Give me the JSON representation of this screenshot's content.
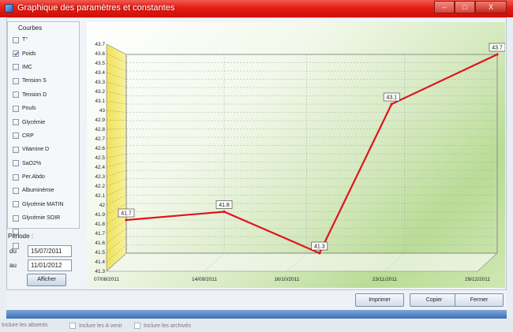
{
  "window": {
    "title": "Graphique des paramètres et constantes",
    "controls": {
      "minimize": "–",
      "maximize": "□",
      "close": "X"
    }
  },
  "curves": {
    "title": "Courbes",
    "items": [
      {
        "label": "T°",
        "checked": false
      },
      {
        "label": "Poids",
        "checked": true
      },
      {
        "label": "IMC",
        "checked": false
      },
      {
        "label": "Tension S",
        "checked": false
      },
      {
        "label": "Tension D",
        "checked": false
      },
      {
        "label": "Pouls",
        "checked": false
      },
      {
        "label": "Glycémie",
        "checked": false
      },
      {
        "label": "CRP",
        "checked": false
      },
      {
        "label": "Vitamine D",
        "checked": false
      },
      {
        "label": "SaO2%",
        "checked": false
      },
      {
        "label": "Per.Abdo",
        "checked": false
      },
      {
        "label": "Albuminémie",
        "checked": false
      },
      {
        "label": "Glycémie MATIN",
        "checked": false
      },
      {
        "label": "Glycémie SOIR",
        "checked": false
      },
      {
        "label": "",
        "checked": false
      },
      {
        "label": "",
        "checked": false
      }
    ]
  },
  "period": {
    "label": "Période :",
    "from_label": "du",
    "from_value": "15/07/2011",
    "to_label": "au",
    "to_value": "11/01/2012",
    "show_button": "Afficher"
  },
  "buttons": {
    "print": "Imprimer",
    "copy": "Copier",
    "close": "Fermer"
  },
  "background_row": {
    "items": [
      "Inclure les absents",
      "Inclure les A venir",
      "Inclure les archivés"
    ]
  },
  "colors": {
    "title_bar": "#e41f15",
    "series_line": "#e0141b",
    "side_wall": "#f4e96a",
    "accent_blue": "#3b6fb8"
  },
  "chart_data": {
    "type": "line",
    "title": "",
    "xlabel": "",
    "ylabel": "",
    "ylim": [
      41.3,
      43.7
    ],
    "y_tick_step": 0.1,
    "grid": true,
    "x_ticks": [
      "07/08/2011",
      "14/09/2011",
      "16/10/2011",
      "23/11/2011",
      "29/12/2011"
    ],
    "series": [
      {
        "values": [
          {
            "x": "07/08/2011",
            "y": 41.7
          },
          {
            "x": "14/09/2011",
            "y": 41.8
          },
          {
            "x": "21/10/2011",
            "y": 41.3
          },
          {
            "x": "18/11/2011",
            "y": 43.1
          },
          {
            "x": "29/12/2011",
            "y": 43.7
          }
        ]
      }
    ]
  }
}
